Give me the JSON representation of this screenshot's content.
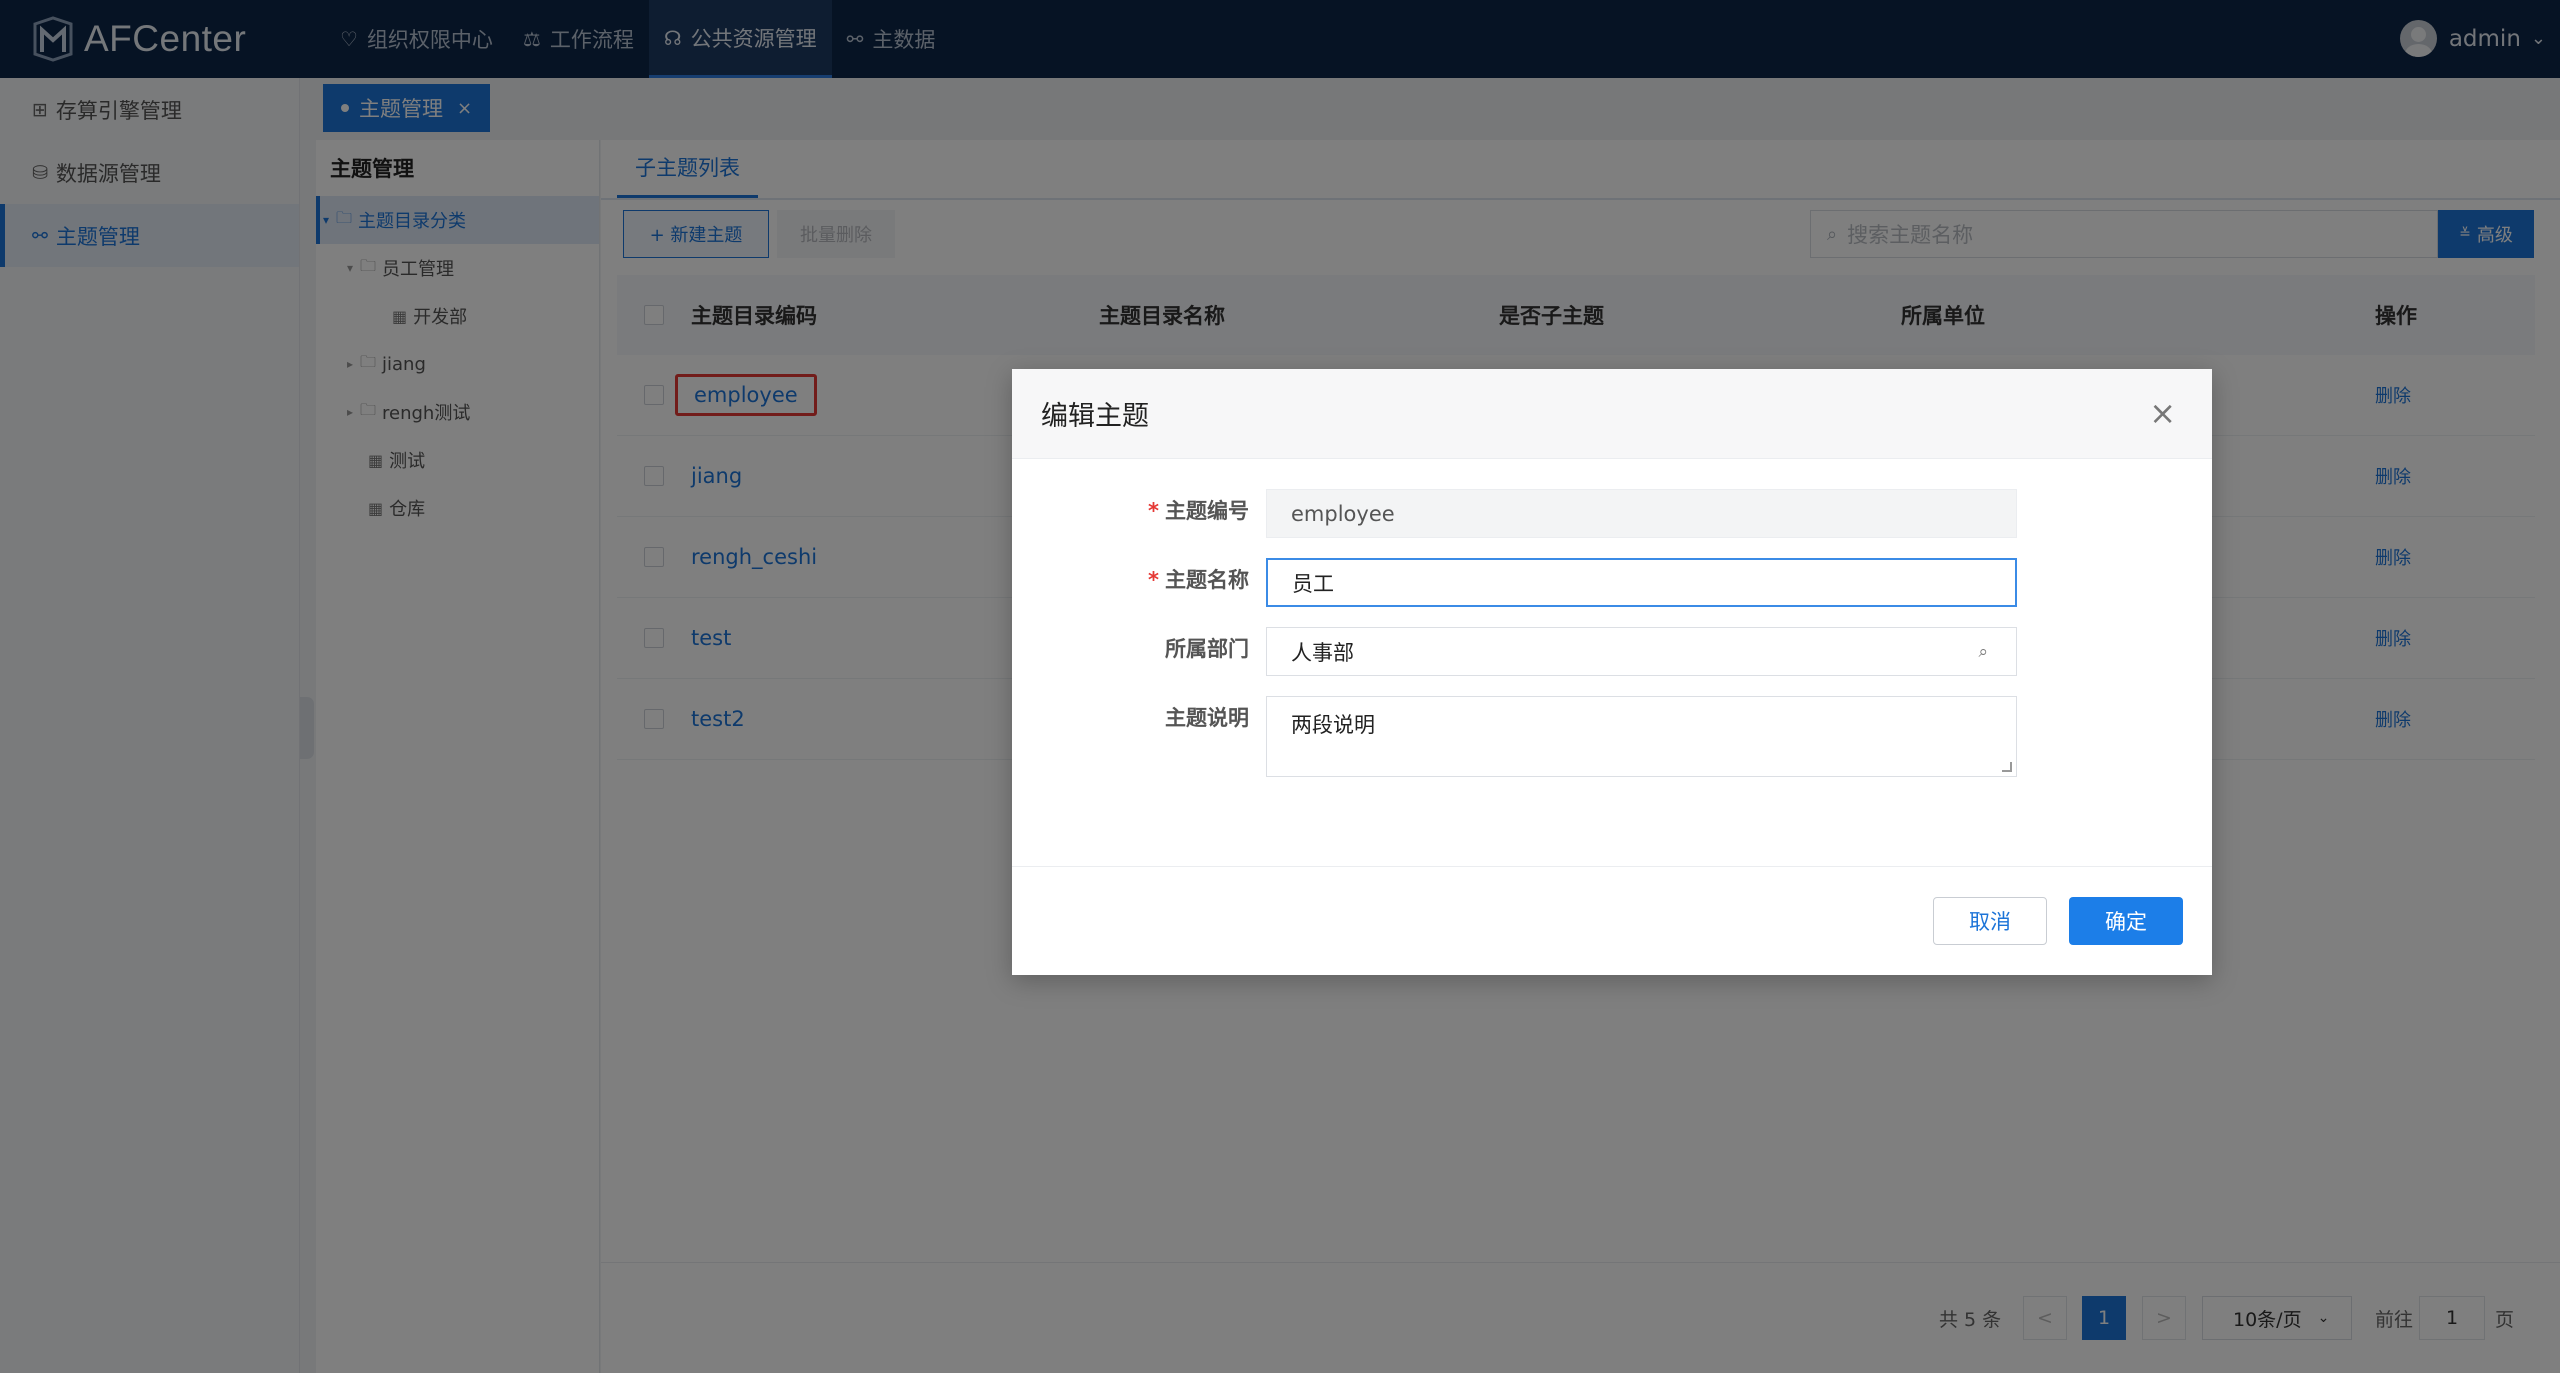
{
  "app": {
    "title": "AFCenter"
  },
  "nav": {
    "items": [
      {
        "label": "组织权限中心",
        "icon": "shield-icon"
      },
      {
        "label": "工作流程",
        "icon": "workflow-icon"
      },
      {
        "label": "公共资源管理",
        "icon": "resource-icon",
        "active": true
      },
      {
        "label": "主数据",
        "icon": "masterdata-icon"
      }
    ]
  },
  "user": {
    "name": "admin"
  },
  "sidebar": {
    "items": [
      {
        "label": "存算引擎管理",
        "icon": "grid-icon"
      },
      {
        "label": "数据源管理",
        "icon": "database-icon"
      },
      {
        "label": "主题管理",
        "icon": "topic-icon",
        "active": true
      }
    ]
  },
  "tabs": {
    "open_tab": "主题管理",
    "close": "×"
  },
  "tree": {
    "title": "主题管理",
    "nodes": [
      {
        "label": "主题目录分类"
      },
      {
        "label": "员工管理"
      },
      {
        "label": "开发部"
      },
      {
        "label": "jiang"
      },
      {
        "label": "rengh测试"
      },
      {
        "label": "测试"
      },
      {
        "label": "仓库"
      }
    ]
  },
  "main": {
    "subtab": "子主题列表",
    "new_button": "+ 新建主题",
    "batch_delete": "批量删除",
    "search_placeholder": "搜索主题名称",
    "advanced": "高级",
    "table": {
      "headers": [
        "主题目录编码",
        "主题目录名称",
        "是否子主题",
        "所属单位",
        "操作"
      ],
      "rows": [
        {
          "code": "employee",
          "op": "删除"
        },
        {
          "code": "jiang",
          "op": "删除"
        },
        {
          "code": "rengh_ceshi",
          "op": "删除"
        },
        {
          "code": "test",
          "op": "删除"
        },
        {
          "code": "test2",
          "op": "删除"
        }
      ]
    },
    "pager": {
      "total": "共 5 条",
      "prev": "<",
      "current": "1",
      "next": ">",
      "page_size": "10条/页",
      "goto_label": "前往",
      "goto_value": "1",
      "page_unit": "页"
    }
  },
  "modal": {
    "title": "编辑主题",
    "close": "×",
    "fields": {
      "code": {
        "label": "主题编号",
        "value": "employee",
        "required": true
      },
      "name": {
        "label": "主题名称",
        "value": "员工",
        "required": true
      },
      "dept": {
        "label": "所属部门",
        "value": "人事部"
      },
      "desc": {
        "label": "主题说明",
        "value": "两段说明"
      }
    },
    "cancel": "取消",
    "ok": "确定"
  },
  "colors": {
    "topbar": "#0d2649",
    "accent": "#1c74d8",
    "highlight": "#e53935"
  }
}
